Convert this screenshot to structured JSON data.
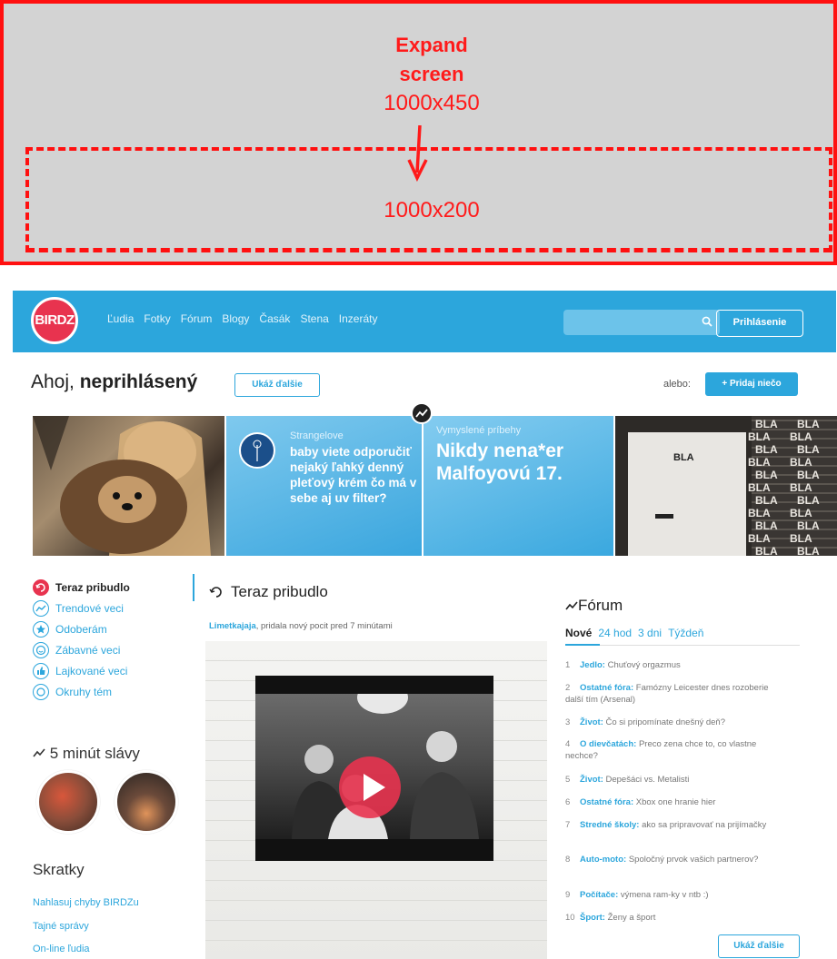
{
  "annotation": {
    "title_line1": "Expand",
    "title_line2": "screen",
    "size_before": "1000x450",
    "size_after": "1000x200"
  },
  "header": {
    "logo": "BIRDZ",
    "nav": [
      "Ľudia",
      "Fotky",
      "Fórum",
      "Blogy",
      "Časák",
      "Stena",
      "Inzeráty"
    ],
    "search_placeholder": "",
    "login": "Prihlásenie"
  },
  "greeting": {
    "hello": "Ahoj,",
    "name": "neprihlásený",
    "more": "Ukáž ďalšie",
    "or": "alebo:",
    "add": "+ Pridaj niečo"
  },
  "featured": [
    {
      "sub": "Strangelove",
      "text": "baby viete odporučiť nejaký ľahký denný pleťový krém čo má v sebe aj uv filter?"
    },
    {
      "sub": "Vymyslené príbehy",
      "text": "Nikdy nena*er Malfoyovú 17."
    },
    {
      "label": "BLA"
    }
  ],
  "sidebar": {
    "items": [
      {
        "label": "Teraz pribudlo",
        "icon": "refresh-icon",
        "active": true
      },
      {
        "label": "Trendové veci",
        "icon": "trend-icon"
      },
      {
        "label": "Odoberám",
        "icon": "star-icon"
      },
      {
        "label": "Zábavné veci",
        "icon": "smile-icon"
      },
      {
        "label": "Lajkované veci",
        "icon": "thumb-up-icon"
      },
      {
        "label": "Okruhy tém",
        "icon": "circle-icon"
      }
    ],
    "fame_title": "5 minút slávy",
    "shortcuts_title": "Skratky",
    "shortcuts": [
      "Nahlasuj chyby BIRDZu",
      "Tajné správy",
      "On-line ľudia"
    ]
  },
  "feed": {
    "title": "Teraz pribudlo",
    "user": "Limetkajaja",
    "meta": ", pridala nový pocit pred 7 minútami"
  },
  "forum": {
    "title": "Fórum",
    "tabs": [
      "Nové",
      "24 hod",
      "3 dni",
      "Týždeň"
    ],
    "items": [
      {
        "n": "1",
        "cat": "Jedlo:",
        "text": "Chuťový orgazmus"
      },
      {
        "n": "2",
        "cat": "Ostatné fóra:",
        "text": "Famózny Leicester dnes rozoberie další tím (Arsenal)"
      },
      {
        "n": "3",
        "cat": "Život:",
        "text": "Čo si pripomínate dnešný deň?"
      },
      {
        "n": "4",
        "cat": "O dievčatách:",
        "text": "Preco zena chce to, co vlastne nechce?"
      },
      {
        "n": "5",
        "cat": "Život:",
        "text": "Depešáci vs. Metalisti"
      },
      {
        "n": "6",
        "cat": "Ostatné fóra:",
        "text": "Xbox one hranie hier"
      },
      {
        "n": "7",
        "cat": "Stredné školy:",
        "text": "ako sa pripravovať na prijímačky"
      },
      {
        "n": "8",
        "cat": "Auto-moto:",
        "text": "Spoločný prvok vašich partnerov?"
      },
      {
        "n": "9",
        "cat": "Počítače:",
        "text": "výmena ram-ky v ntb :)"
      },
      {
        "n": "10",
        "cat": "Šport:",
        "text": "Ženy a šport"
      }
    ],
    "more": "Ukáž ďalšie"
  }
}
